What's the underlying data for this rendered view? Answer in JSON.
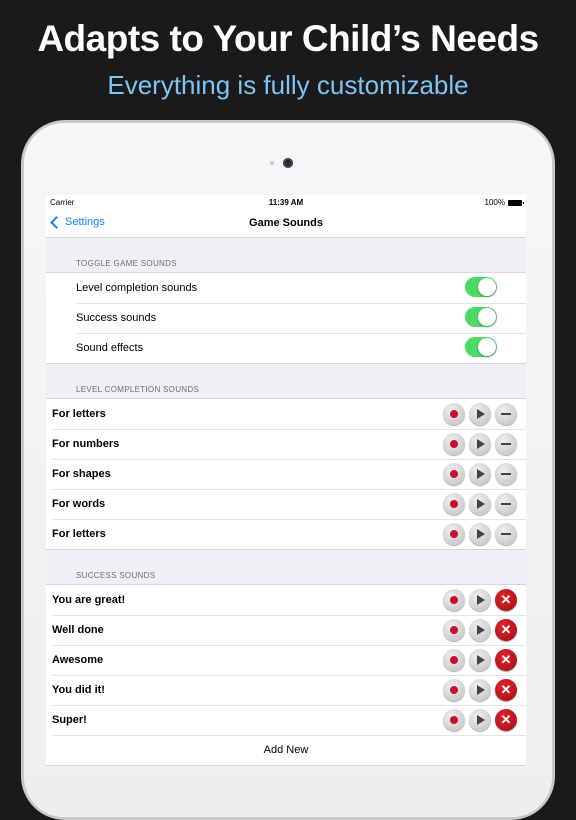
{
  "promo": {
    "headline": "Adapts to Your Child’s Needs",
    "subheadline": "Everything is fully customizable"
  },
  "status_bar": {
    "carrier": "Carrier",
    "time": "11:39 AM",
    "battery": "100%"
  },
  "nav": {
    "back_label": "Settings",
    "title": "Game Sounds"
  },
  "toggle_section": {
    "header": "TOGGLE GAME SOUNDS",
    "items": [
      {
        "label": "Level completion sounds",
        "enabled": true
      },
      {
        "label": "Success sounds",
        "enabled": true
      },
      {
        "label": "Sound effects",
        "enabled": true
      }
    ]
  },
  "level_section": {
    "header": "LEVEL COMPLETION SOUNDS",
    "items": [
      {
        "label": "For letters"
      },
      {
        "label": "For numbers"
      },
      {
        "label": "For shapes"
      },
      {
        "label": "For words"
      },
      {
        "label": "For letters"
      }
    ]
  },
  "success_section": {
    "header": "SUCCESS SOUNDS",
    "items": [
      {
        "label": "You are great!"
      },
      {
        "label": "Well done"
      },
      {
        "label": "Awesome"
      },
      {
        "label": "You did it!"
      },
      {
        "label": "Super!"
      }
    ],
    "add_new_label": "Add New"
  },
  "colors": {
    "accent": "#1a7cf5",
    "toggle_on": "#4cd964",
    "record": "#c8102e",
    "delete": "#d0161c",
    "subheadline": "#7ec4f2"
  },
  "icons": {
    "record": "record-icon",
    "play": "play-icon",
    "remove": "minus-icon",
    "delete": "close-icon",
    "back": "chevron-left-icon"
  }
}
